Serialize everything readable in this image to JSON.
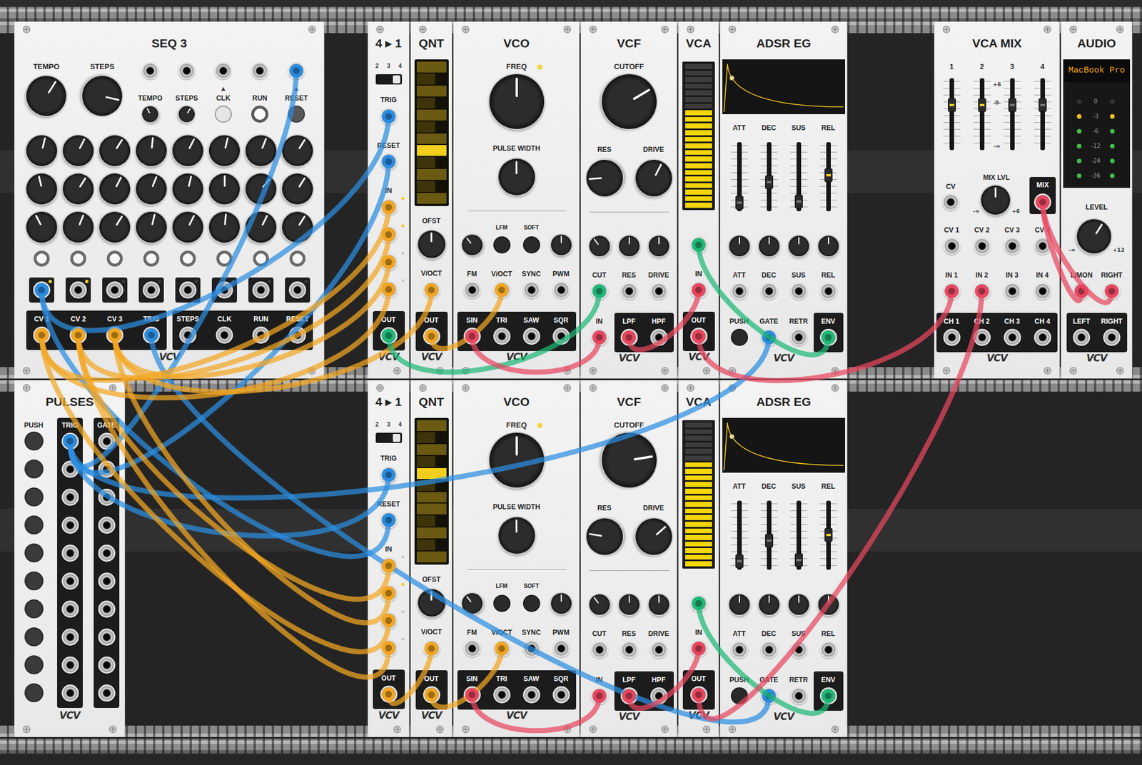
{
  "brand": "VCV",
  "rows": [
    {
      "modules": [
        {
          "kind": "seq3",
          "title": "SEQ 3",
          "mainKnobs": [
            {
              "label": "TEMPO",
              "level": 0.62
            },
            {
              "label": "STEPS",
              "level": 0.88
            }
          ],
          "inputs": [
            {
              "label": "TEMPO",
              "mark": "",
              "kind": "trim",
              "level": 0.4,
              "lit": false
            },
            {
              "label": "STEPS",
              "mark": "",
              "kind": "trim",
              "level": 0.62,
              "lit": false
            },
            {
              "label": "CLK",
              "mark": "▲",
              "kind": "button",
              "level": 0,
              "lit": true
            },
            {
              "label": "RUN",
              "mark": "",
              "kind": "latch",
              "level": 0,
              "lit": true
            },
            {
              "label": "RESET",
              "mark": "▲",
              "kind": "button",
              "level": 0,
              "lit": false
            }
          ],
          "grid": [
            [
              0.55,
              0.6,
              0.62,
              0.52,
              0.6,
              0.55,
              0.58,
              0.62
            ],
            [
              0.45,
              0.62,
              0.6,
              0.58,
              0.55,
              0.5,
              0.65,
              0.62
            ],
            [
              0.4,
              0.58,
              0.62,
              0.55,
              0.6,
              0.52,
              0.6,
              0.62
            ]
          ],
          "gates": [
            {
              "on": true
            },
            {
              "on": true
            },
            {
              "on": true
            },
            {
              "on": true
            },
            {
              "on": true
            },
            {
              "on": true
            },
            {
              "on": true
            },
            {
              "on": true
            }
          ],
          "gateOuts": [
            {
              "lit": true
            },
            {
              "lit": true
            },
            {
              "lit": false
            },
            {
              "lit": false
            },
            {
              "lit": false
            },
            {
              "lit": false
            },
            {
              "lit": false
            },
            {
              "lit": false
            }
          ],
          "outputs": [
            {
              "labels": [
                "CV 1",
                "CV 2",
                "CV 3",
                "TRIG"
              ]
            },
            {
              "labels": [
                "STEPS",
                "CLK",
                "RUN",
                "RESET"
              ]
            }
          ]
        },
        {
          "kind": "fourone",
          "title": "4 ▸ 1",
          "modes": [
            {
              "label": "2",
              "selected": false
            },
            {
              "label": "3",
              "selected": false
            },
            {
              "label": "4",
              "selected": true
            }
          ],
          "trig": "TRIG",
          "reset": "RESET",
          "inLabel": "IN",
          "ins": [
            {
              "lit": true
            },
            {
              "lit": true
            },
            {
              "lit": false
            },
            {
              "lit": false
            }
          ],
          "out": "OUT"
        },
        {
          "kind": "qnt",
          "title": "QNT",
          "keys": [
            {
              "black": false,
              "selected": false
            },
            {
              "black": true,
              "selected": false
            },
            {
              "black": false,
              "selected": false
            },
            {
              "black": true,
              "selected": false
            },
            {
              "black": false,
              "selected": false
            },
            {
              "black": true,
              "selected": false
            },
            {
              "black": false,
              "selected": false
            },
            {
              "black": false,
              "selected": true
            },
            {
              "black": true,
              "selected": false
            },
            {
              "black": false,
              "selected": false
            },
            {
              "black": true,
              "selected": false
            },
            {
              "black": false,
              "selected": false
            }
          ],
          "offset": {
            "label": "OFST",
            "level": 0.5
          },
          "in": "V/OCT",
          "out": "OUT"
        },
        {
          "kind": "vco",
          "title": "VCO",
          "freq": {
            "label": "FREQ",
            "level": 0.5,
            "lit": true
          },
          "pw": {
            "label": "PULSE WIDTH",
            "level": 0.5
          },
          "mods": [
            {
              "kind": "knob",
              "label": "",
              "level": 0.36
            },
            {
              "kind": "button",
              "label": "LFM",
              "level": 0
            },
            {
              "kind": "button",
              "label": "SOFT",
              "level": 0
            },
            {
              "kind": "knob",
              "label": "",
              "level": 0.5
            }
          ],
          "ins": [
            "FM",
            "V/OCT",
            "SYNC",
            "PWM"
          ],
          "outs": [
            "SIN",
            "TRI",
            "SAW",
            "SQR"
          ]
        },
        {
          "kind": "vcf",
          "title": "VCF",
          "cutoff": {
            "label": "CUTOFF",
            "level": 0.72
          },
          "res": {
            "label": "RES",
            "level": 0.15
          },
          "drive": {
            "label": "DRIVE",
            "level": 0.6
          },
          "atten": [
            0.36,
            0.5,
            0.5
          ],
          "ins": [
            "CUT",
            "RES",
            "DRIVE"
          ],
          "in": "IN",
          "outs": [
            "LPF",
            "HPF"
          ]
        },
        {
          "kind": "vca",
          "title": "VCA",
          "level": 0.69,
          "in": "IN",
          "out": "OUT"
        },
        {
          "kind": "adsr",
          "title": "ADSR EG",
          "sliders": [
            {
              "label": "ATT",
              "level": 0.04,
              "lit": false
            },
            {
              "label": "DEC",
              "level": 0.4,
              "lit": false
            },
            {
              "label": "SUS",
              "level": 0.06,
              "lit": false
            },
            {
              "label": "REL",
              "level": 0.53,
              "lit": true
            }
          ],
          "knobs": [
            0.5,
            0.5,
            0.5,
            0.5
          ],
          "ins": [
            "ATT",
            "DEC",
            "SUS",
            "REL"
          ],
          "push": "PUSH",
          "gate": "GATE",
          "retr": "RETR",
          "env": "ENV"
        },
        {
          "kind": "vcamix",
          "title": "VCA MIX",
          "channels": [
            {
              "label": "1",
              "level": 0.65,
              "lit": true
            },
            {
              "label": "2",
              "level": 0.65,
              "lit": true
            },
            {
              "label": "3",
              "level": 0.65,
              "lit": false
            },
            {
              "label": "4",
              "level": 0.65,
              "lit": false
            }
          ],
          "scale": [
            "+6",
            "-0-",
            "-∞"
          ],
          "cv": "CV",
          "mixLvl": {
            "label": "MIX LVL",
            "level": 0.5,
            "min": "-∞",
            "max": "+6"
          },
          "mix": "MIX",
          "cvs": [
            "CV 1",
            "CV 2",
            "CV 3",
            "CV 4"
          ],
          "ins": [
            "IN 1",
            "IN 2",
            "IN 3",
            "IN 4"
          ],
          "outs": [
            "CH 1",
            "CH 2",
            "CH 3",
            "CH 4"
          ]
        },
        {
          "kind": "audio",
          "title": "AUDIO",
          "device": "MacBook Pro",
          "meter": [
            {
              "label": "0",
              "left": false,
              "right": false,
              "color": "#f2c21b"
            },
            {
              "label": "-3",
              "left": true,
              "right": true,
              "color": "#f2c21b"
            },
            {
              "label": "-6",
              "left": true,
              "right": true,
              "color": "#3fbf4a"
            },
            {
              "label": "-12",
              "left": true,
              "right": true,
              "color": "#3fbf4a"
            },
            {
              "label": "-24",
              "left": true,
              "right": true,
              "color": "#3fbf4a"
            },
            {
              "label": "-36",
              "left": true,
              "right": true,
              "color": "#3fbf4a"
            }
          ],
          "level": {
            "label": "LEVEL",
            "level": 0.62,
            "min": "-∞",
            "max": "+12"
          },
          "ins": [
            "L/MON",
            "RIGHT"
          ],
          "outs": [
            "LEFT",
            "RIGHT"
          ]
        }
      ]
    },
    {
      "modules": [
        {
          "kind": "pulses",
          "title": "PULSES",
          "headers": [
            "PUSH",
            "TRIG",
            "GATE"
          ],
          "rows": [
            {
              "pressed": false
            },
            {
              "pressed": false
            },
            {
              "pressed": false
            },
            {
              "pressed": false
            },
            {
              "pressed": false
            },
            {
              "pressed": false
            },
            {
              "pressed": false
            },
            {
              "pressed": false
            },
            {
              "pressed": false
            },
            {
              "pressed": false
            }
          ]
        },
        {
          "kind": "fourone",
          "title": "4 ▸ 1",
          "modes": [
            {
              "label": "2",
              "selected": false
            },
            {
              "label": "3",
              "selected": false
            },
            {
              "label": "4",
              "selected": true
            }
          ],
          "trig": "TRIG",
          "reset": "RESET",
          "inLabel": "IN",
          "ins": [
            {
              "lit": false
            },
            {
              "lit": true
            },
            {
              "lit": false
            },
            {
              "lit": false
            }
          ],
          "out": "OUT"
        },
        {
          "kind": "qnt",
          "title": "QNT",
          "keys": [
            {
              "black": false,
              "selected": false
            },
            {
              "black": true,
              "selected": false
            },
            {
              "black": false,
              "selected": false
            },
            {
              "black": true,
              "selected": false
            },
            {
              "black": false,
              "selected": true
            },
            {
              "black": true,
              "selected": false
            },
            {
              "black": false,
              "selected": false
            },
            {
              "black": false,
              "selected": false
            },
            {
              "black": true,
              "selected": false
            },
            {
              "black": false,
              "selected": false
            },
            {
              "black": true,
              "selected": false
            },
            {
              "black": false,
              "selected": false
            }
          ],
          "offset": {
            "label": "OFST",
            "level": 0.5
          },
          "in": "V/OCT",
          "out": "OUT"
        },
        {
          "kind": "vco",
          "title": "VCO",
          "freq": {
            "label": "FREQ",
            "level": 0.5,
            "lit": true
          },
          "pw": {
            "label": "PULSE WIDTH",
            "level": 0.5
          },
          "mods": [
            {
              "kind": "knob",
              "label": "",
              "level": 0.36
            },
            {
              "kind": "button",
              "label": "LFM",
              "level": 0
            },
            {
              "kind": "button",
              "label": "SOFT",
              "level": 0
            },
            {
              "kind": "knob",
              "label": "",
              "level": 0.5
            }
          ],
          "ins": [
            "FM",
            "V/OCT",
            "SYNC",
            "PWM"
          ],
          "outs": [
            "SIN",
            "TRI",
            "SAW",
            "SQR"
          ]
        },
        {
          "kind": "vcf",
          "title": "VCF",
          "cutoff": {
            "label": "CUTOFF",
            "level": 0.8
          },
          "res": {
            "label": "RES",
            "level": 0.2
          },
          "drive": {
            "label": "DRIVE",
            "level": 0.68
          },
          "atten": [
            0.36,
            0.5,
            0.5
          ],
          "ins": [
            "CUT",
            "RES",
            "DRIVE"
          ],
          "in": "IN",
          "outs": [
            "LPF",
            "HPF"
          ]
        },
        {
          "kind": "vca",
          "title": "VCA",
          "level": 0.72,
          "in": "IN",
          "out": "OUT"
        },
        {
          "kind": "adsr",
          "title": "ADSR EG",
          "sliders": [
            {
              "label": "ATT",
              "level": 0.04,
              "lit": false
            },
            {
              "label": "DEC",
              "level": 0.4,
              "lit": false
            },
            {
              "label": "SUS",
              "level": 0.06,
              "lit": false
            },
            {
              "label": "REL",
              "level": 0.5,
              "lit": true
            }
          ],
          "knobs": [
            0.5,
            0.5,
            0.5,
            0.5
          ],
          "ins": [
            "ATT",
            "DEC",
            "SUS",
            "REL"
          ],
          "push": "PUSH",
          "gate": "GATE",
          "retr": "RETR",
          "env": "ENV"
        }
      ]
    }
  ],
  "cables": [
    {
      "from": "0.0.gate.0",
      "to": "0.1.trig.0",
      "color": "#2b8de0"
    },
    {
      "from": "1.0.trig.0",
      "to": "0.0.in.4",
      "color": "#2b8de0"
    },
    {
      "from": "1.0.trig.0",
      "to": "0.1.reset.0",
      "color": "#2b8de0"
    },
    {
      "from": "1.0.trig.0",
      "to": "1.1.trig.0",
      "color": "#2b8de0"
    },
    {
      "from": "0.0.gate.0",
      "to": "1.1.reset.0",
      "color": "#2b8de0"
    },
    {
      "from": "0.0.out.3",
      "to": "1.6.gate.0",
      "color": "#2b8de0"
    },
    {
      "from": "1.0.trig.0",
      "to": "0.6.gate.0",
      "color": "#2b8de0"
    },
    {
      "from": "0.0.out.0",
      "to": "0.1.in.0",
      "color": "#f2a623"
    },
    {
      "from": "0.0.out.1",
      "to": "0.1.in.1",
      "color": "#f2a623"
    },
    {
      "from": "0.0.out.2",
      "to": "0.1.in.2",
      "color": "#f2a623"
    },
    {
      "from": "0.0.out.0",
      "to": "0.1.in.3",
      "color": "#f2a623"
    },
    {
      "from": "0.0.out.1",
      "to": "1.1.in.0",
      "color": "#f2a623"
    },
    {
      "from": "0.0.out.2",
      "to": "1.1.in.1",
      "color": "#f2a623"
    },
    {
      "from": "0.0.out.0",
      "to": "1.1.in.2",
      "color": "#f2a623"
    },
    {
      "from": "0.0.out.1",
      "to": "1.1.in.3",
      "color": "#f2a623"
    },
    {
      "from": "0.0.out.2",
      "to": "0.2.in.0",
      "color": "#f2a623"
    },
    {
      "from": "0.2.out.0",
      "to": "0.3.in.1",
      "color": "#f2a623"
    },
    {
      "from": "1.1.out.0",
      "to": "1.2.in.0",
      "color": "#f2a623"
    },
    {
      "from": "1.2.out.0",
      "to": "1.3.in.1",
      "color": "#f2a623"
    },
    {
      "from": "0.1.out.0",
      "to": "0.4.in.0",
      "color": "#1fb877"
    },
    {
      "from": "0.5.cv.0",
      "to": "0.6.env.0",
      "color": "#1fb877"
    },
    {
      "from": "1.5.cv.0",
      "to": "1.6.env.0",
      "color": "#1fb877"
    },
    {
      "from": "0.3.out.0",
      "to": "0.4.audio.0",
      "color": "#e8475f"
    },
    {
      "from": "0.4.out.0",
      "to": "0.5.in.0",
      "color": "#e8475f"
    },
    {
      "from": "0.5.out.0",
      "to": "0.7.in.0",
      "color": "#e8475f"
    },
    {
      "from": "1.3.out.0",
      "to": "1.4.audio.0",
      "color": "#e8475f"
    },
    {
      "from": "1.4.out.0",
      "to": "1.5.in.0",
      "color": "#e8475f"
    },
    {
      "from": "1.5.out.0",
      "to": "0.7.in.1",
      "color": "#e8475f"
    },
    {
      "from": "0.7.mix.0",
      "to": "0.8.in.0",
      "color": "#e8475f"
    },
    {
      "from": "0.7.mix.0",
      "to": "0.8.in.1",
      "color": "#e8475f"
    }
  ]
}
